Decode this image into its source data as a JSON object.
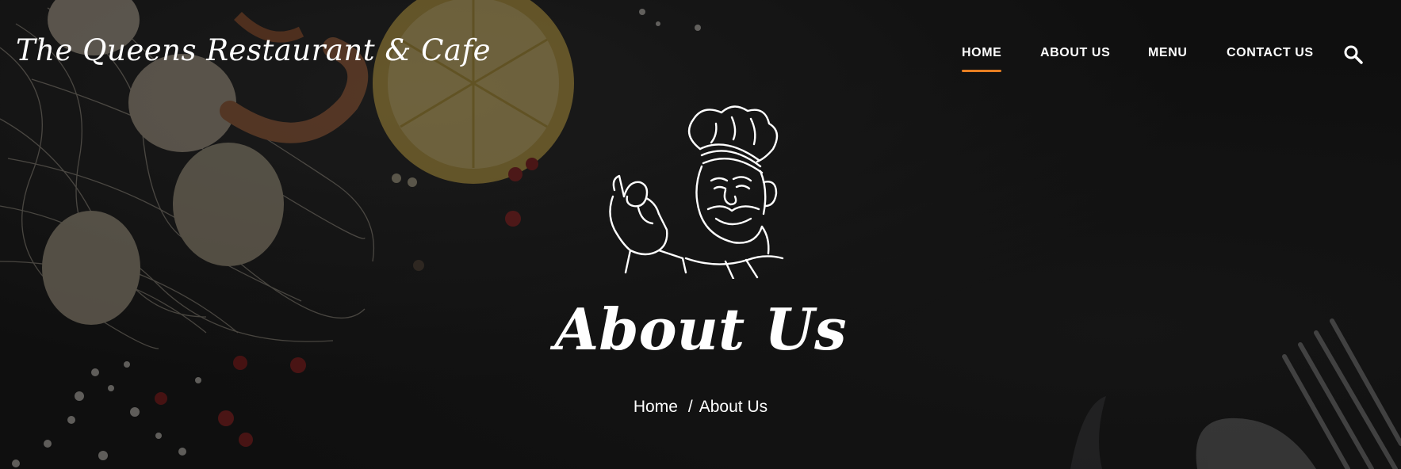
{
  "site": {
    "logo": "The Queens Restaurant & Cafe"
  },
  "nav": {
    "items": [
      {
        "label": "HOME",
        "active": true
      },
      {
        "label": "ABOUT US",
        "active": false
      },
      {
        "label": "MENU",
        "active": false
      },
      {
        "label": "CONTACT US",
        "active": false
      }
    ],
    "search_icon": "search-icon"
  },
  "hero": {
    "illustration": "chef-icon",
    "title": "About Us",
    "breadcrumb": {
      "home": "Home",
      "separator": "/",
      "current": "About Us"
    }
  },
  "colors": {
    "accent": "#e67e22",
    "background": "#151515",
    "text": "#ffffff"
  }
}
